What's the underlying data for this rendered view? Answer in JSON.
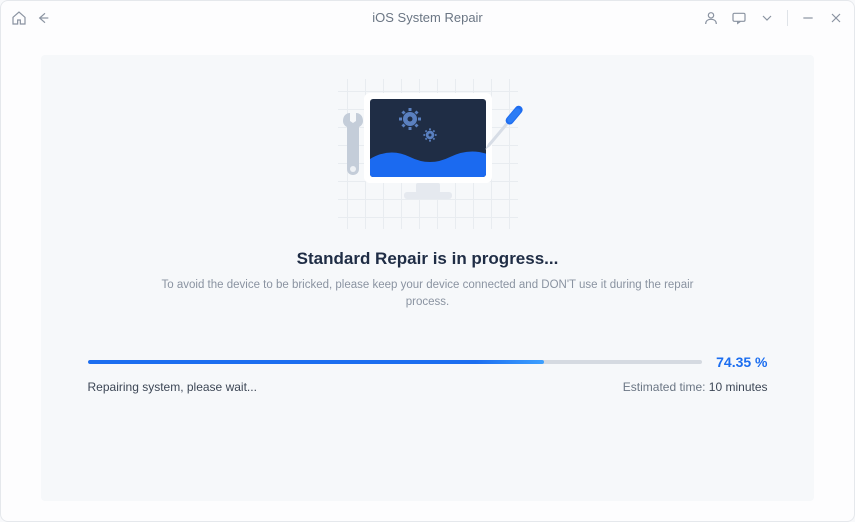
{
  "titlebar": {
    "title": "iOS System Repair"
  },
  "main": {
    "heading": "Standard Repair is in progress...",
    "subtext": "To avoid the device to be bricked, please keep your device connected and DON'T use it during the repair process."
  },
  "progress": {
    "percent_text": "74.35 %",
    "percent_value": 74.35,
    "status_text": "Repairing system, please wait...",
    "estimated_label": "Estimated time: ",
    "estimated_value": "10 minutes"
  }
}
